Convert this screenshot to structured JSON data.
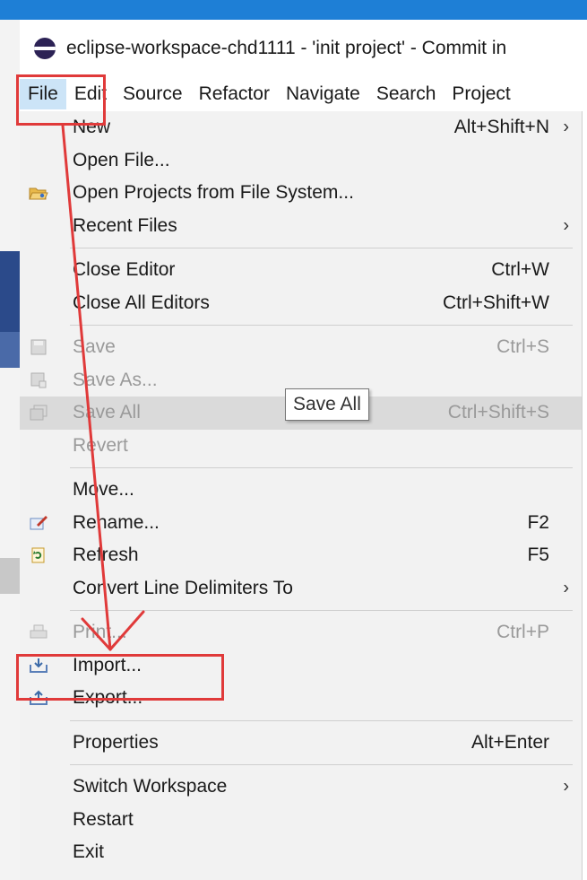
{
  "window": {
    "title": "eclipse-workspace-chd1111 - 'init project' - Commit in"
  },
  "menubar": {
    "items": [
      "File",
      "Edit",
      "Source",
      "Refactor",
      "Navigate",
      "Search",
      "Project"
    ],
    "active": "File"
  },
  "file_menu": {
    "new": {
      "label": "New",
      "shortcut": "Alt+Shift+N"
    },
    "open_file": {
      "label": "Open File..."
    },
    "open_projects": {
      "label": "Open Projects from File System..."
    },
    "recent_files": {
      "label": "Recent Files"
    },
    "close_editor": {
      "label": "Close Editor",
      "shortcut": "Ctrl+W"
    },
    "close_all_editors": {
      "label": "Close All Editors",
      "shortcut": "Ctrl+Shift+W"
    },
    "save": {
      "label": "Save",
      "shortcut": "Ctrl+S"
    },
    "save_as": {
      "label": "Save As..."
    },
    "save_all": {
      "label": "Save All",
      "shortcut": "Ctrl+Shift+S"
    },
    "revert": {
      "label": "Revert"
    },
    "move": {
      "label": "Move..."
    },
    "rename": {
      "label": "Rename...",
      "shortcut": "F2"
    },
    "refresh": {
      "label": "Refresh",
      "shortcut": "F5"
    },
    "convert_line_delimiters": {
      "label": "Convert Line Delimiters To"
    },
    "print": {
      "label": "Print...",
      "shortcut": "Ctrl+P"
    },
    "import": {
      "label": "Import..."
    },
    "export": {
      "label": "Export..."
    },
    "properties": {
      "label": "Properties",
      "shortcut": "Alt+Enter"
    },
    "switch_workspace": {
      "label": "Switch Workspace"
    },
    "restart": {
      "label": "Restart"
    },
    "exit": {
      "label": "Exit"
    }
  },
  "tooltip": {
    "text": "Save All"
  },
  "annotation": {
    "color": "#e03a3a"
  },
  "colors": {
    "menu_bg": "#f2f2f2",
    "active_menu_bg": "#cce4f7",
    "disabled_text": "#9a9a9a",
    "top_strip": "#1e7fd6"
  }
}
